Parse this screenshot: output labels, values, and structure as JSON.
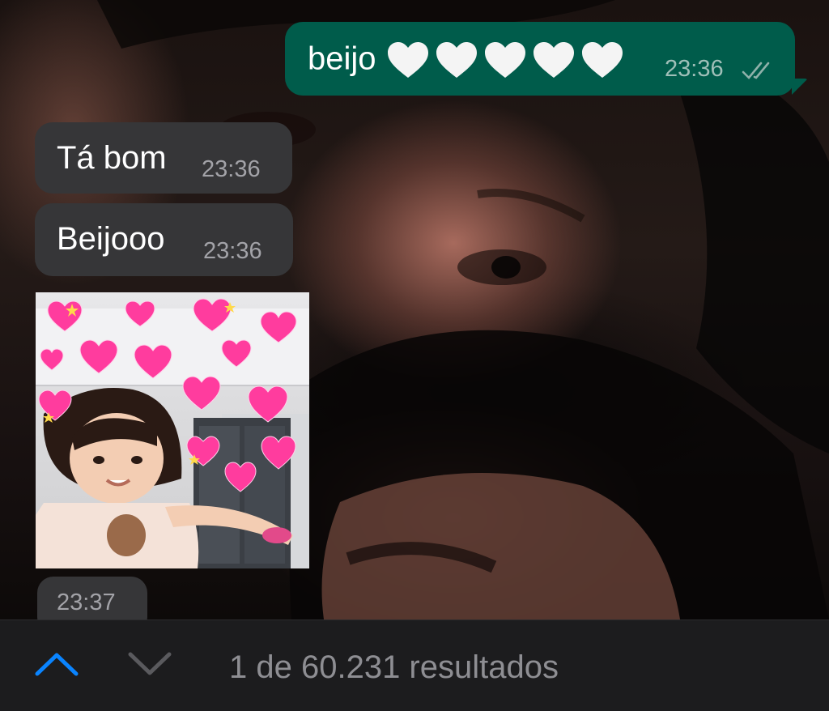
{
  "messages": {
    "outgoing": {
      "text": "beijo",
      "hearts": [
        "white-heart-icon",
        "white-heart-icon",
        "white-heart-icon",
        "white-heart-icon",
        "white-heart-icon"
      ],
      "time": "23:36",
      "status": "read-double-check-icon"
    },
    "incoming": [
      {
        "text": "Tá bom",
        "time": "23:36"
      },
      {
        "text": "Beijooo",
        "time": "23:36"
      }
    ],
    "sticker": {
      "time": "23:37"
    }
  },
  "search": {
    "up_icon": "chevron-up-icon",
    "down_icon": "chevron-down-icon",
    "result_count": "1 de 60.231 resultados"
  },
  "colors": {
    "outgoing_bubble": "#005c4b",
    "incoming_bubble": "#363638",
    "accent": "#0a84ff",
    "search_bar": "#1c1c1e"
  }
}
